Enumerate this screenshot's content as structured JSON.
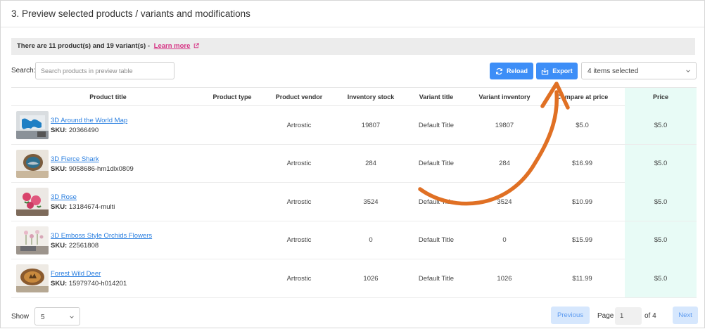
{
  "header": {
    "title": "3. Preview selected products / variants and modifications"
  },
  "notice": {
    "text": "There are 11 product(s) and 19 variant(s) -",
    "link_label": "Learn more"
  },
  "search": {
    "label": "Search:",
    "placeholder": "Search products in preview table"
  },
  "toolbar": {
    "reload_label": "Reload",
    "export_label": "Export",
    "selection_label": "4 items selected"
  },
  "colors": {
    "accent": "#3d8ef7",
    "link": "#2a7fe0",
    "learn_more": "#d63384",
    "price_bg": "#e8fbf6",
    "arrow": "#e07024"
  },
  "table": {
    "columns": [
      "Product title",
      "Product type",
      "Product vendor",
      "Inventory stock",
      "Variant title",
      "Variant inventory",
      "Compare at price",
      "Price"
    ],
    "rows": [
      {
        "title": "3D Around the World Map",
        "sku_label": "SKU:",
        "sku": "20366490",
        "type": "",
        "vendor": "Artrostic",
        "stock": "19807",
        "variant_title": "Default Title",
        "variant_inventory": "19807",
        "compare_price": "$5.0",
        "price": "$5.0"
      },
      {
        "title": "3D Fierce Shark",
        "sku_label": "SKU:",
        "sku": "9058686-hm1dlx0809",
        "type": "",
        "vendor": "Artrostic",
        "stock": "284",
        "variant_title": "Default Title",
        "variant_inventory": "284",
        "compare_price": "$16.99",
        "price": "$5.0"
      },
      {
        "title": "3D Rose",
        "sku_label": "SKU:",
        "sku": "13184674-multi",
        "type": "",
        "vendor": "Artrostic",
        "stock": "3524",
        "variant_title": "Default Title",
        "variant_inventory": "3524",
        "compare_price": "$10.99",
        "price": "$5.0"
      },
      {
        "title": "3D Emboss Style Orchids Flowers",
        "sku_label": "SKU:",
        "sku": "22561808",
        "type": "",
        "vendor": "Artrostic",
        "stock": "0",
        "variant_title": "Default Title",
        "variant_inventory": "0",
        "compare_price": "$15.99",
        "price": "$5.0"
      },
      {
        "title": "Forest Wild Deer",
        "sku_label": "SKU:",
        "sku": "15979740-h014201",
        "type": "",
        "vendor": "Artrostic",
        "stock": "1026",
        "variant_title": "Default Title",
        "variant_inventory": "1026",
        "compare_price": "$11.99",
        "price": "$5.0"
      }
    ]
  },
  "footer": {
    "show_label": "Show",
    "page_size": "5",
    "prev_label": "Previous",
    "page_label": "Page",
    "page_value": "1",
    "of_label": "of 4",
    "next_label": "Next"
  }
}
